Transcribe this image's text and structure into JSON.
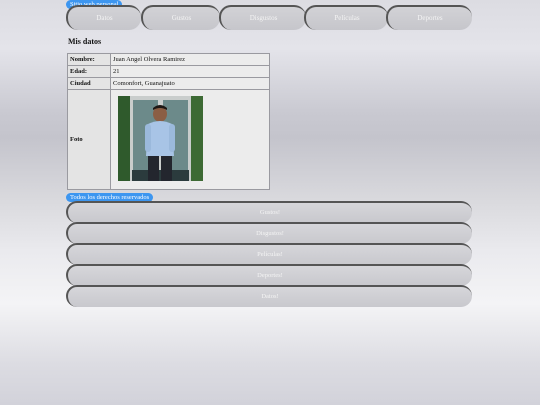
{
  "header": {
    "badge": "Sitio web personal"
  },
  "nav": {
    "tabs": [
      {
        "label": "Datos"
      },
      {
        "label": "Gustos"
      },
      {
        "label": "Disgustos"
      },
      {
        "label": "Películas"
      },
      {
        "label": "Deportes"
      }
    ]
  },
  "main": {
    "title": "Mis datos",
    "rows": [
      {
        "key": "Nombre:",
        "value": "Juan Angel Olvera Ramirez"
      },
      {
        "key": "Edad:",
        "value": "21"
      },
      {
        "key": "Ciudad",
        "value": "Comonfort, Guanajuato"
      }
    ],
    "photo_key": "Foto"
  },
  "footer": {
    "badge": "Todos los derechos reservados",
    "links": [
      {
        "label": "Gustos!"
      },
      {
        "label": "Disgustos!"
      },
      {
        "label": "Películas!"
      },
      {
        "label": "Deportes!"
      },
      {
        "label": "Datos!"
      }
    ]
  }
}
